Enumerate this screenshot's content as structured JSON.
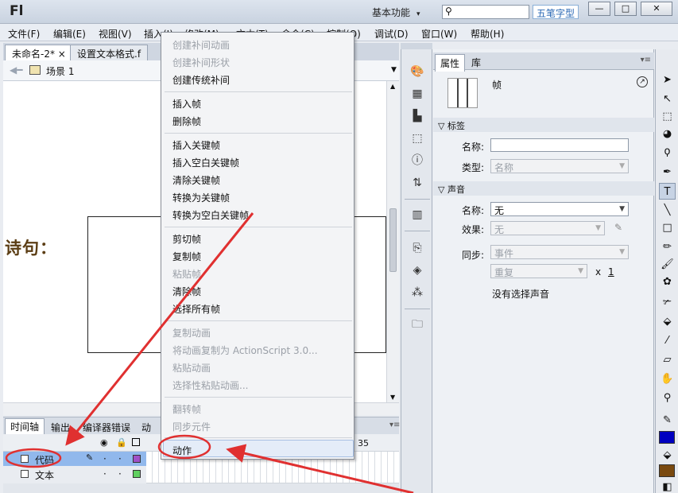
{
  "app": {
    "logo": "Fl",
    "workspace": "基本功能",
    "ime_badge": "五笔字型"
  },
  "window_controls": {
    "minimize": "—",
    "maximize": "□",
    "close": "✕"
  },
  "menu": [
    "文件(F)",
    "编辑(E)",
    "视图(V)",
    "插入(I)",
    "修改(M)",
    "文本(T)",
    "命令(C)",
    "控制(O)",
    "调试(D)",
    "窗口(W)",
    "帮助(H)"
  ],
  "doc_tabs": [
    {
      "label": "未命名-2*",
      "close": "×"
    },
    {
      "label": "设置文本格式.f"
    }
  ],
  "scene": {
    "label": "场景 1"
  },
  "stage": {
    "poem_label": "诗句："
  },
  "timeline": {
    "tabs": [
      "时间轴",
      "输出",
      "编译器错误",
      "动"
    ],
    "ruler_number": "35",
    "layers": [
      {
        "name": "代码",
        "selected": true,
        "color": "#a050c8"
      },
      {
        "name": "文本",
        "selected": false,
        "color": "#60d060"
      }
    ]
  },
  "context_menu": {
    "groups": [
      [
        {
          "label": "创建补间动画",
          "enabled": false
        },
        {
          "label": "创建补间形状",
          "enabled": false
        },
        {
          "label": "创建传统补间",
          "enabled": true
        }
      ],
      [
        {
          "label": "插入帧",
          "enabled": true
        },
        {
          "label": "删除帧",
          "enabled": true
        }
      ],
      [
        {
          "label": "插入关键帧",
          "enabled": true
        },
        {
          "label": "插入空白关键帧",
          "enabled": true
        },
        {
          "label": "清除关键帧",
          "enabled": true
        },
        {
          "label": "转换为关键帧",
          "enabled": true
        },
        {
          "label": "转换为空白关键帧",
          "enabled": true
        }
      ],
      [
        {
          "label": "剪切帧",
          "enabled": true
        },
        {
          "label": "复制帧",
          "enabled": true
        },
        {
          "label": "粘贴帧",
          "enabled": false
        },
        {
          "label": "清除帧",
          "enabled": true
        },
        {
          "label": "选择所有帧",
          "enabled": true
        }
      ],
      [
        {
          "label": "复制动画",
          "enabled": false
        },
        {
          "label": "将动画复制为 ActionScript 3.0...",
          "enabled": false
        },
        {
          "label": "粘贴动画",
          "enabled": false
        },
        {
          "label": "选择性粘贴动画...",
          "enabled": false
        }
      ],
      [
        {
          "label": "翻转帧",
          "enabled": false
        },
        {
          "label": "同步元件",
          "enabled": false
        }
      ],
      [
        {
          "label": "动作",
          "enabled": true,
          "highlighted": true
        }
      ]
    ]
  },
  "properties": {
    "tabs": [
      "属性",
      "库"
    ],
    "object_type": "帧",
    "label_section": {
      "title": "标签",
      "name_label": "名称:",
      "name_value": "",
      "type_label": "类型:",
      "type_value": "名称"
    },
    "sound_section": {
      "title": "声音",
      "name_label": "名称:",
      "name_value": "无",
      "effect_label": "效果:",
      "effect_value": "无",
      "sync_label": "同步:",
      "sync_value": "事件",
      "repeat_value": "重复",
      "times_label": "x",
      "times_value": "1",
      "status": "没有选择声音"
    }
  },
  "colors": {
    "stroke": "#0000c0",
    "fill": "#7a4a10",
    "annotation": "#e03030"
  }
}
